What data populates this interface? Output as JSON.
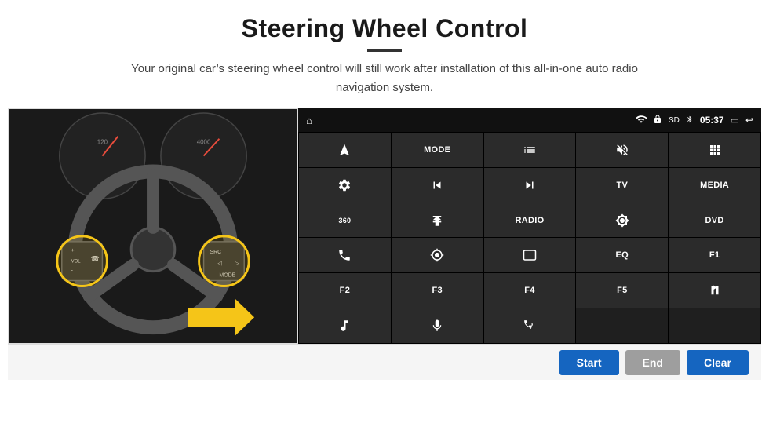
{
  "header": {
    "title": "Steering Wheel Control",
    "divider": true,
    "subtitle": "Your original car’s steering wheel control will still work after installation of this all-in-one auto radio navigation system."
  },
  "statusbar": {
    "home_icon": "home",
    "wifi_icon": "wifi",
    "lock_icon": "lock",
    "sd_icon": "sd",
    "bt_icon": "bluetooth",
    "time": "05:37",
    "screen_icon": "screen",
    "back_icon": "back"
  },
  "buttons": [
    {
      "id": "r1c1",
      "type": "icon",
      "label": "navigate"
    },
    {
      "id": "r1c2",
      "type": "text",
      "label": "MODE"
    },
    {
      "id": "r1c3",
      "type": "icon",
      "label": "list"
    },
    {
      "id": "r1c4",
      "type": "icon",
      "label": "mute"
    },
    {
      "id": "r1c5",
      "type": "icon",
      "label": "apps"
    },
    {
      "id": "r2c1",
      "type": "icon",
      "label": "settings"
    },
    {
      "id": "r2c2",
      "type": "icon",
      "label": "prev"
    },
    {
      "id": "r2c3",
      "type": "icon",
      "label": "next"
    },
    {
      "id": "r2c4",
      "type": "text",
      "label": "TV"
    },
    {
      "id": "r2c5",
      "type": "text",
      "label": "MEDIA"
    },
    {
      "id": "r3c1",
      "type": "icon",
      "label": "360cam"
    },
    {
      "id": "r3c2",
      "type": "icon",
      "label": "eject"
    },
    {
      "id": "r3c3",
      "type": "text",
      "label": "RADIO"
    },
    {
      "id": "r3c4",
      "type": "icon",
      "label": "brightness"
    },
    {
      "id": "r3c5",
      "type": "text",
      "label": "DVD"
    },
    {
      "id": "r4c1",
      "type": "icon",
      "label": "phone"
    },
    {
      "id": "r4c2",
      "type": "icon",
      "label": "gps"
    },
    {
      "id": "r4c3",
      "type": "icon",
      "label": "aspect"
    },
    {
      "id": "r4c4",
      "type": "text",
      "label": "EQ"
    },
    {
      "id": "r4c5",
      "type": "text",
      "label": "F1"
    },
    {
      "id": "r5c1",
      "type": "text",
      "label": "F2"
    },
    {
      "id": "r5c2",
      "type": "text",
      "label": "F3"
    },
    {
      "id": "r5c3",
      "type": "text",
      "label": "F4"
    },
    {
      "id": "r5c4",
      "type": "text",
      "label": "F5"
    },
    {
      "id": "r5c5",
      "type": "icon",
      "label": "playpause"
    },
    {
      "id": "r6c1",
      "type": "icon",
      "label": "music"
    },
    {
      "id": "r6c2",
      "type": "icon",
      "label": "mic"
    },
    {
      "id": "r6c3",
      "type": "icon",
      "label": "phone-sound"
    },
    {
      "id": "r6c4",
      "type": "empty",
      "label": ""
    },
    {
      "id": "r6c5",
      "type": "empty",
      "label": ""
    }
  ],
  "bottom": {
    "start_label": "Start",
    "end_label": "End",
    "clear_label": "Clear"
  }
}
